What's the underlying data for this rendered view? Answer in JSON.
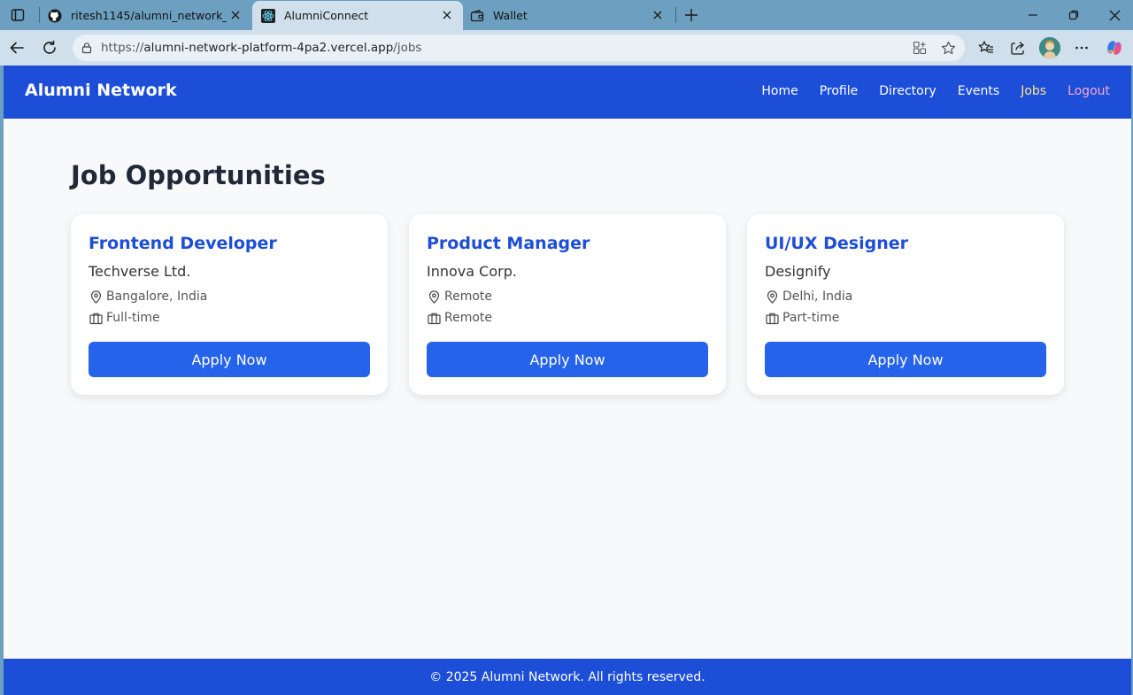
{
  "browser": {
    "tabs": [
      {
        "title": "ritesh1145/alumni_network_platfo",
        "icon": "github-icon",
        "active": false
      },
      {
        "title": "AlumniConnect",
        "icon": "react-icon",
        "active": true
      },
      {
        "title": "Wallet",
        "icon": "wallet-icon",
        "active": false
      }
    ],
    "url_prefix": "https://",
    "url_host": "alumni-network-platform-4pa2.vercel.app",
    "url_path": "/jobs"
  },
  "site": {
    "brand": "Alumni Network",
    "nav": [
      {
        "label": "Home"
      },
      {
        "label": "Profile"
      },
      {
        "label": "Directory"
      },
      {
        "label": "Events"
      },
      {
        "label": "Jobs"
      },
      {
        "label": "Logout"
      }
    ]
  },
  "page": {
    "heading": "Job Opportunities",
    "jobs": [
      {
        "title": "Frontend Developer",
        "company": "Techverse Ltd.",
        "location": "Bangalore, India",
        "type": "Full-time",
        "apply_label": "Apply Now"
      },
      {
        "title": "Product Manager",
        "company": "Innova Corp.",
        "location": "Remote",
        "type": "Remote",
        "apply_label": "Apply Now"
      },
      {
        "title": "UI/UX Designer",
        "company": "Designify",
        "location": "Delhi, India",
        "type": "Part-time",
        "apply_label": "Apply Now"
      }
    ]
  },
  "footer": {
    "text": "© 2025 Alumni Network. All rights reserved."
  }
}
